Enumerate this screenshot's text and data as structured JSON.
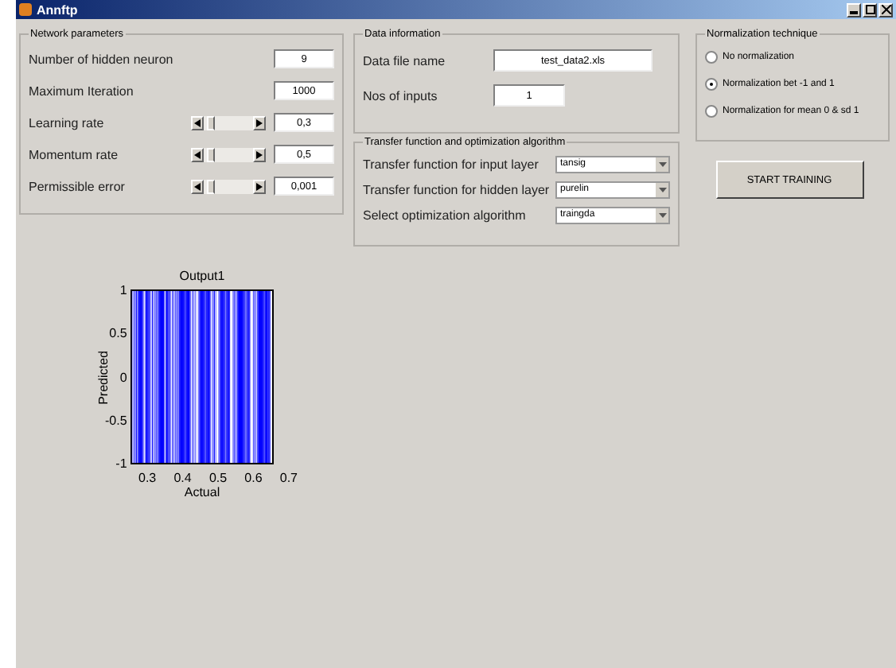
{
  "window": {
    "title": "Annftp"
  },
  "network_parameters": {
    "title": "Network parameters",
    "rows": [
      {
        "kind": "field",
        "label": "Number of hidden neuron",
        "value": "9"
      },
      {
        "kind": "field",
        "label": "Maximum Iteration",
        "value": "1000"
      },
      {
        "kind": "slider",
        "label": "Learning rate",
        "value": "0,3",
        "level": 0.05
      },
      {
        "kind": "slider",
        "label": "Momentum rate",
        "value": "0,5",
        "level": 0.05
      },
      {
        "kind": "slider",
        "label": "Permissible error",
        "value": "0,001",
        "level": 0.05
      }
    ]
  },
  "data_information": {
    "title": "Data information",
    "file_label": "Data file name",
    "file_value": "test_data2.xls",
    "inputs_label": "Nos of inputs",
    "inputs_value": "1"
  },
  "transfer": {
    "title": "Transfer function and optimization algorithm",
    "rows": [
      {
        "label": "Transfer function for input layer",
        "value": "tansig"
      },
      {
        "label": "Transfer function for hidden layer",
        "value": "purelin"
      },
      {
        "label": "Select optimization algorithm",
        "value": "traingda"
      }
    ]
  },
  "normalization": {
    "title": "Normalization technique",
    "options": [
      {
        "label": "No normalization",
        "selected": false
      },
      {
        "label": "Normalization bet -1 and 1",
        "selected": true
      },
      {
        "label": "Normalization for mean 0 & sd 1",
        "selected": false
      }
    ]
  },
  "start_button": "START TRAINING",
  "plot": {
    "title": "Output1",
    "xlabel": "Actual",
    "ylabel": "Predicted",
    "xticks": [
      "0.3",
      "0.4",
      "0.5",
      "0.6",
      "0.7"
    ],
    "yticks": [
      "1",
      "0.5",
      "0",
      "-0.5",
      "-1"
    ]
  }
}
